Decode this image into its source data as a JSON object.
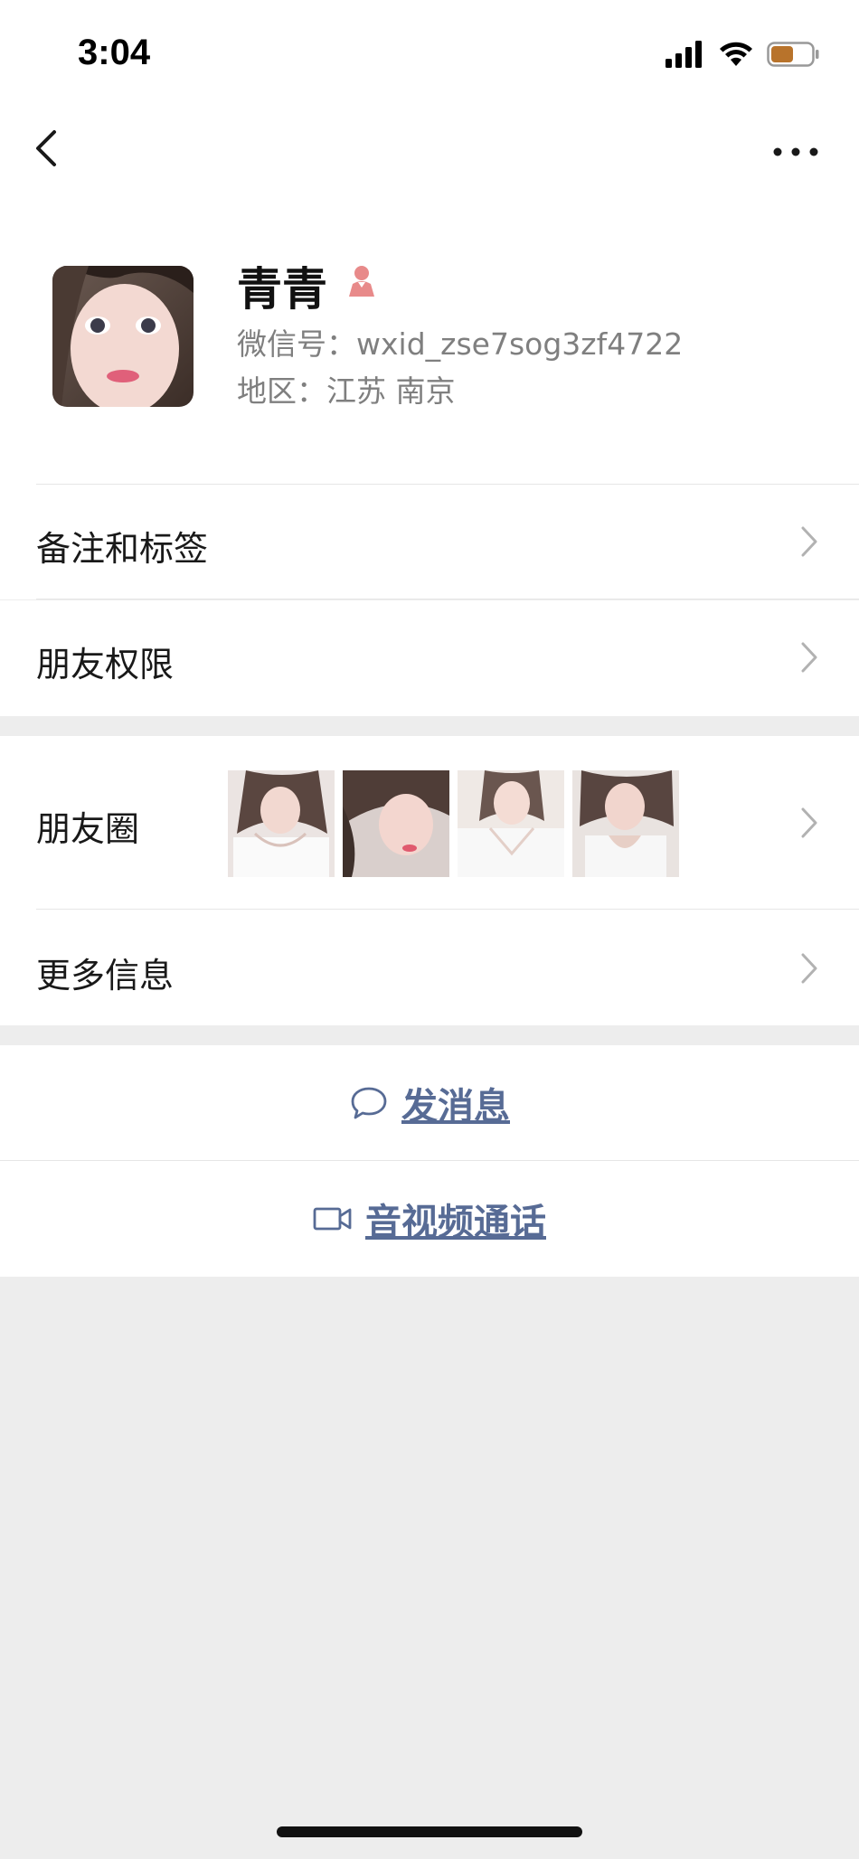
{
  "status_bar": {
    "time": "3:04"
  },
  "profile": {
    "name": "青青",
    "wechat_id": "微信号：wxid_zse7sog3zf4722",
    "region": "地区：江苏 南京"
  },
  "rows": {
    "remarks_tags": "备注和标签",
    "friend_permissions": "朋友权限",
    "moments": "朋友圈",
    "more_info": "更多信息"
  },
  "actions": {
    "send_message": "发消息",
    "video_call": "音视频通话"
  },
  "colors": {
    "link": "#576b95",
    "background": "#ededed",
    "gender_icon": "#e88a8a"
  }
}
